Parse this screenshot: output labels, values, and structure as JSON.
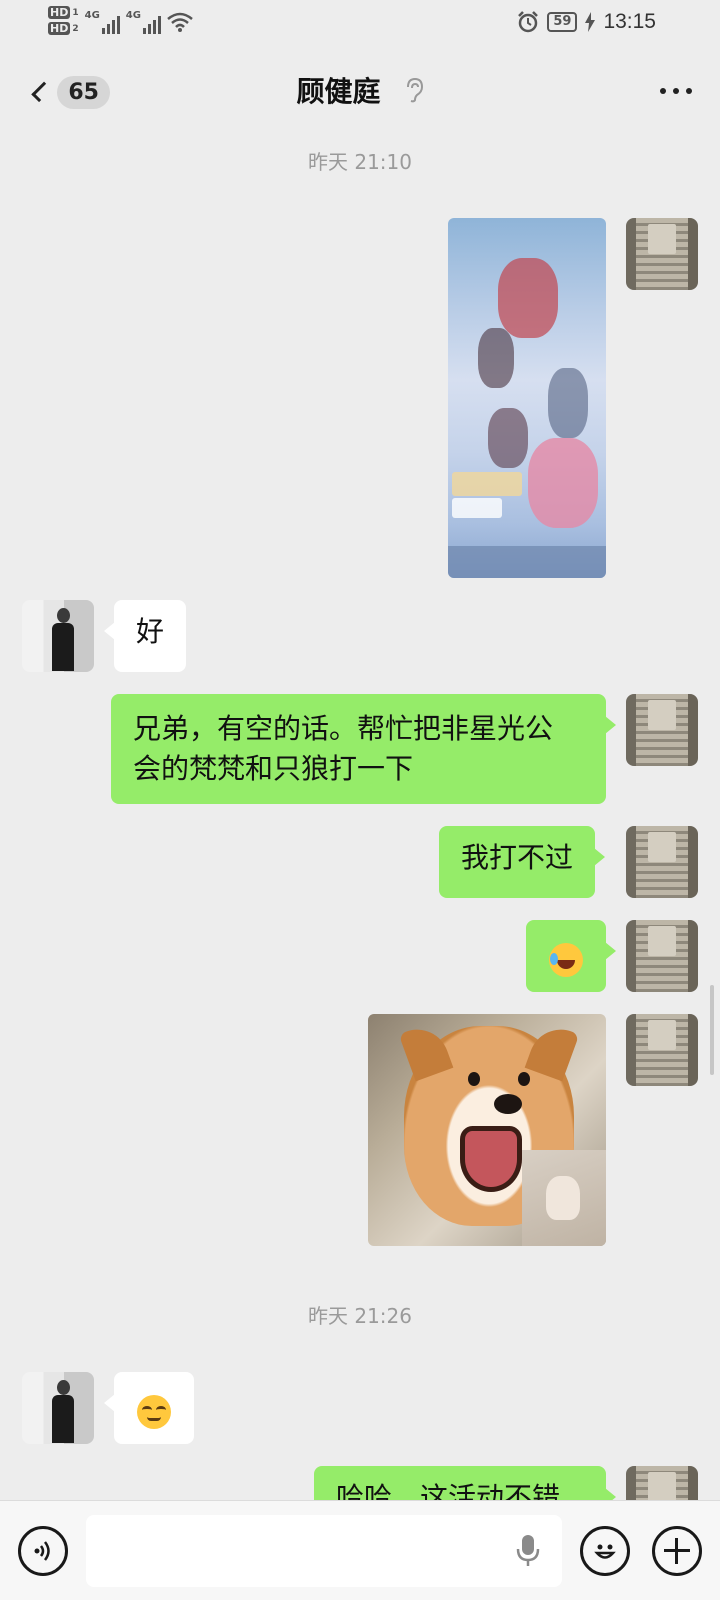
{
  "status_bar": {
    "hd1": "HD",
    "hd1_sub": "1",
    "hd2": "HD",
    "hd2_sub": "2",
    "network1": "4G",
    "network2": "4G",
    "battery": "59",
    "time": "13:15"
  },
  "header": {
    "unread_count": "65",
    "title": "顾健庭",
    "icons": [
      "back-chevron-icon",
      "earpiece-mode-icon",
      "more-icon"
    ]
  },
  "messages": [
    {
      "type": "timestamp",
      "text": "昨天 21:10"
    },
    {
      "type": "image",
      "sender": "me",
      "content": "game screenshot"
    },
    {
      "type": "text",
      "sender": "friend",
      "text": "好"
    },
    {
      "type": "text",
      "sender": "me",
      "text_line1": "兄弟，有空的话。帮忙把非星光公",
      "text_line2": "会的梵梵和只狼打一下"
    },
    {
      "type": "text",
      "sender": "me",
      "text": "我打不过"
    },
    {
      "type": "emoji",
      "sender": "me",
      "emoji": "laughing-crying-emoji"
    },
    {
      "type": "image",
      "sender": "me",
      "content": "shiba dog thumbs-up sticker"
    },
    {
      "type": "timestamp",
      "text": "昨天 21:26"
    },
    {
      "type": "emoji",
      "sender": "friend",
      "emoji": "smirk-emoji"
    },
    {
      "type": "text",
      "sender": "me",
      "text": "哈哈，这活动不错"
    }
  ],
  "input_bar": {
    "placeholder": "",
    "icons": [
      "voice-mode-icon",
      "microphone-icon",
      "emoji-icon",
      "plus-icon"
    ]
  },
  "colors": {
    "background": "#ededed",
    "my_bubble": "#95ec69",
    "friend_bubble": "#ffffff",
    "timestamp_text": "#9a9a9a"
  }
}
